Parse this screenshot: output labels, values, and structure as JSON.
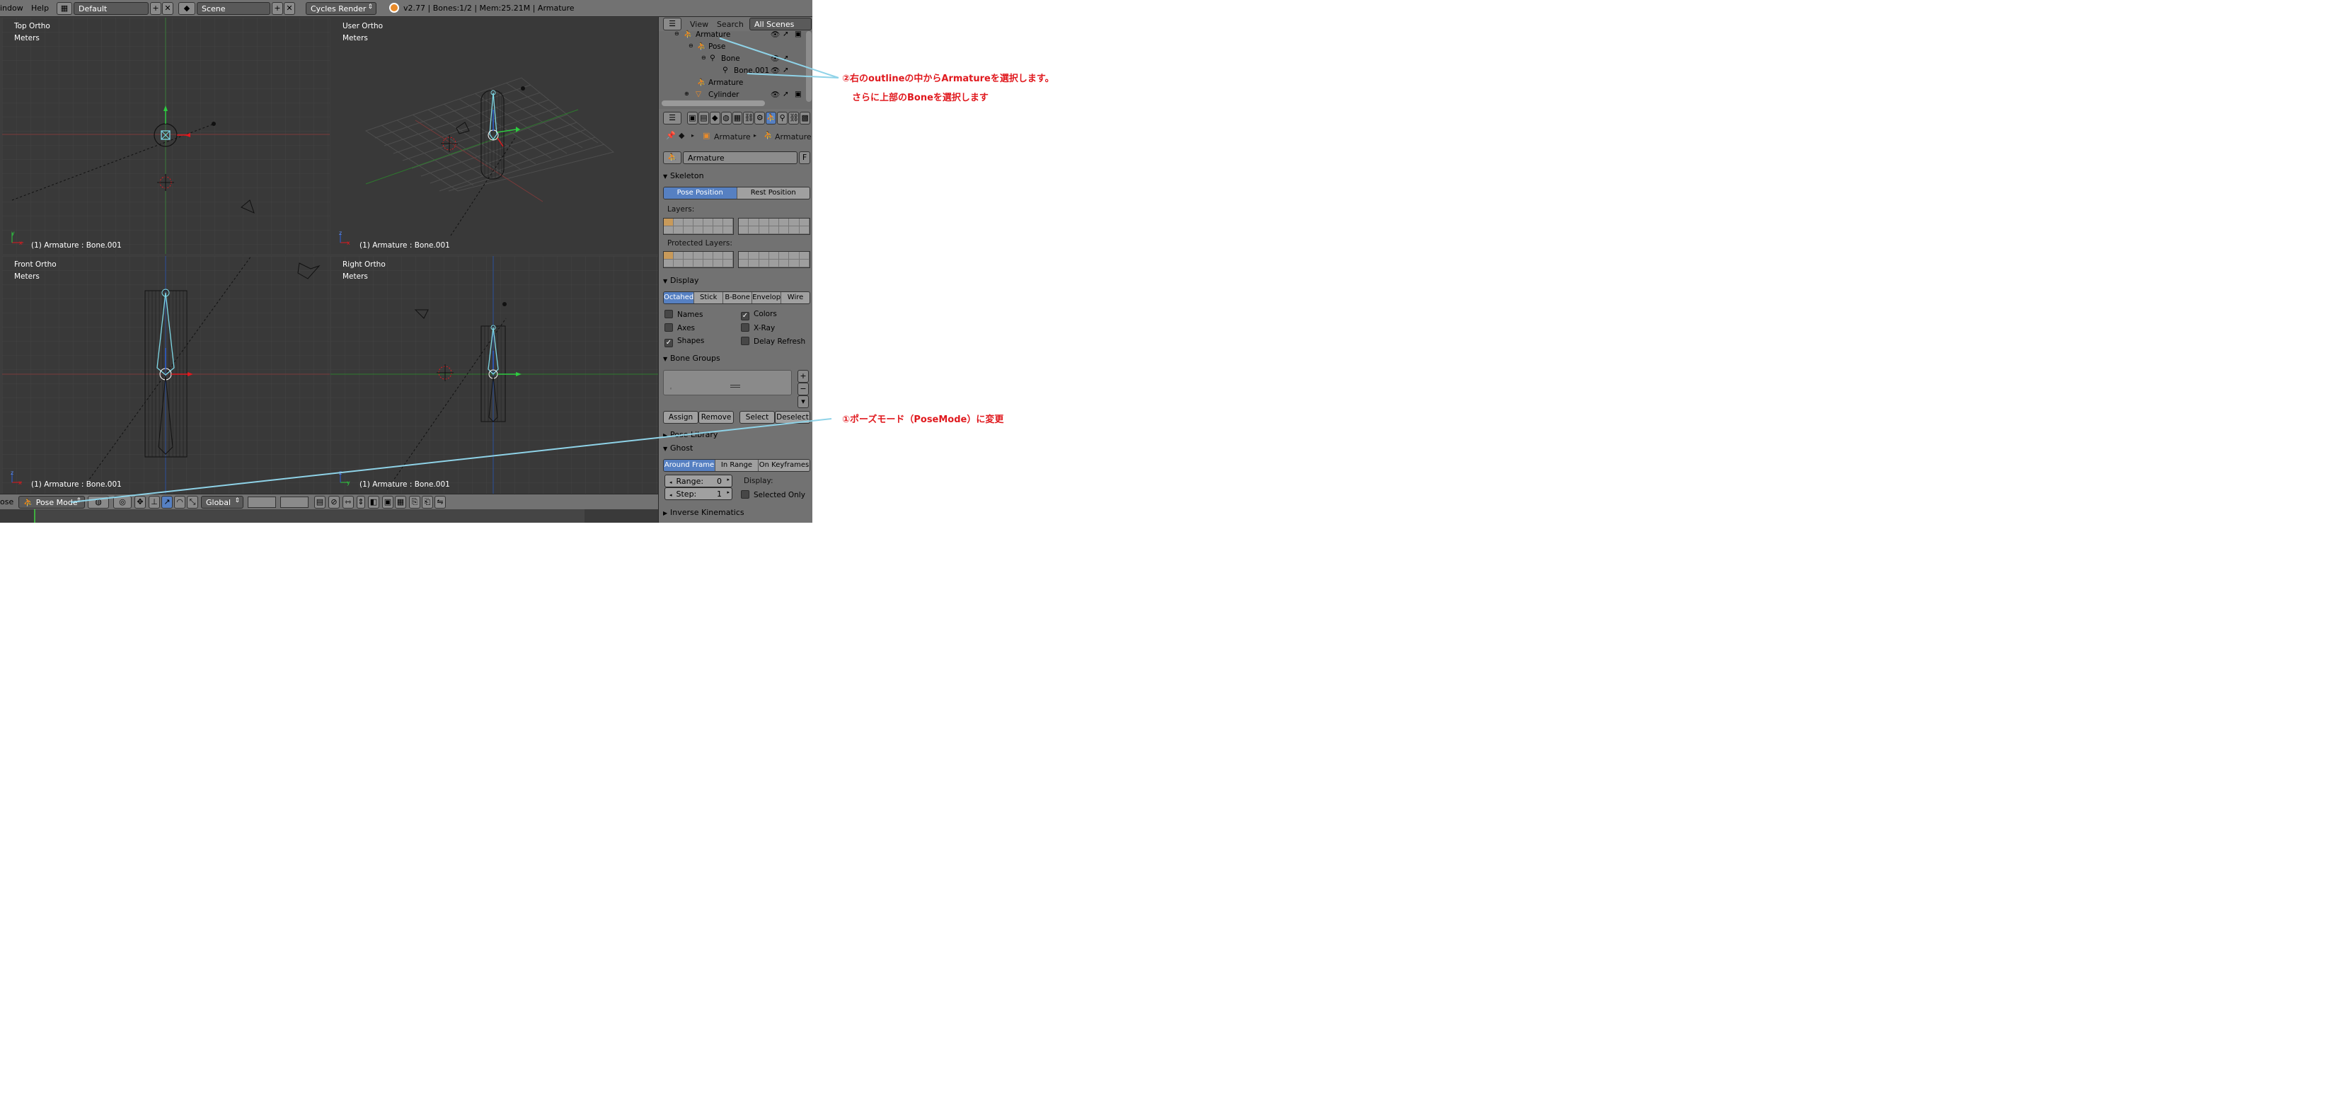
{
  "menu": {
    "window": "indow",
    "help": "Help"
  },
  "screen_layout": "Default",
  "scene_name": "Scene",
  "render_engine": "Cycles Render",
  "status": "v2.77 | Bones:1/2  | Mem:25.21M | Armature",
  "viewports": [
    {
      "name": "Top Ortho",
      "units": "Meters",
      "footer": "(1) Armature : Bone.001",
      "axes": [
        "x",
        "y"
      ]
    },
    {
      "name": "User Ortho",
      "units": "Meters",
      "footer": "(1) Armature : Bone.001",
      "axes": [
        "x",
        "z"
      ]
    },
    {
      "name": "Front Ortho",
      "units": "Meters",
      "footer": "(1) Armature : Bone.001",
      "axes": [
        "x",
        "z"
      ]
    },
    {
      "name": "Right Ortho",
      "units": "Meters",
      "footer": "(1) Armature : Bone.001",
      "axes": [
        "y",
        "z"
      ]
    }
  ],
  "view3d_header": {
    "mode_prefix": "ose",
    "mode": "Pose Mode",
    "orientation": "Global"
  },
  "outliner": {
    "menus": [
      "View",
      "Search"
    ],
    "filter": "All Scenes",
    "rows": [
      "Armature",
      "Pose",
      "Bone",
      "Bone.001",
      "Armature",
      "Cylinder"
    ]
  },
  "properties": {
    "breadcrumb": [
      "Armature",
      "Armature"
    ],
    "datablock": "Armature",
    "fake_user": "F",
    "skeleton": {
      "title": "Skeleton",
      "pose_position": "Pose Position",
      "rest_position": "Rest Position",
      "layers_label": "Layers:",
      "protected_label": "Protected Layers:"
    },
    "display": {
      "title": "Display",
      "types": [
        "Octahed",
        "Stick",
        "B-Bone",
        "Envelop",
        "Wire"
      ],
      "checks": [
        {
          "label": "Names",
          "checked": false
        },
        {
          "label": "Colors",
          "checked": true
        },
        {
          "label": "Axes",
          "checked": false
        },
        {
          "label": "X-Ray",
          "checked": false
        },
        {
          "label": "Shapes",
          "checked": true
        },
        {
          "label": "Delay Refresh",
          "checked": false
        }
      ]
    },
    "bone_groups": {
      "title": "Bone Groups",
      "buttons": [
        "Assign",
        "Remove",
        "Select",
        "Deselect"
      ]
    },
    "pose_library": {
      "title": "Pose Library"
    },
    "ghost": {
      "title": "Ghost",
      "types": [
        "Around Frame",
        "In Range",
        "On Keyframes"
      ],
      "range_label": "Range:",
      "range": "0",
      "step_label": "Step:",
      "step": "1",
      "display_label": "Display:",
      "selected_only": "Selected Only"
    },
    "ik": {
      "title": "Inverse Kinematics"
    }
  },
  "annotations": {
    "step2_line1": "②右のoutlineの中からArmatureを選択します。",
    "step2_line2": "さらに上部のBoneを選択します",
    "step1": "①ポーズモード（PoseMode）に変更"
  },
  "colors": {
    "annotation": "#e0191e",
    "leader_line": "#8fd3e8",
    "accent": "#5680c2"
  }
}
